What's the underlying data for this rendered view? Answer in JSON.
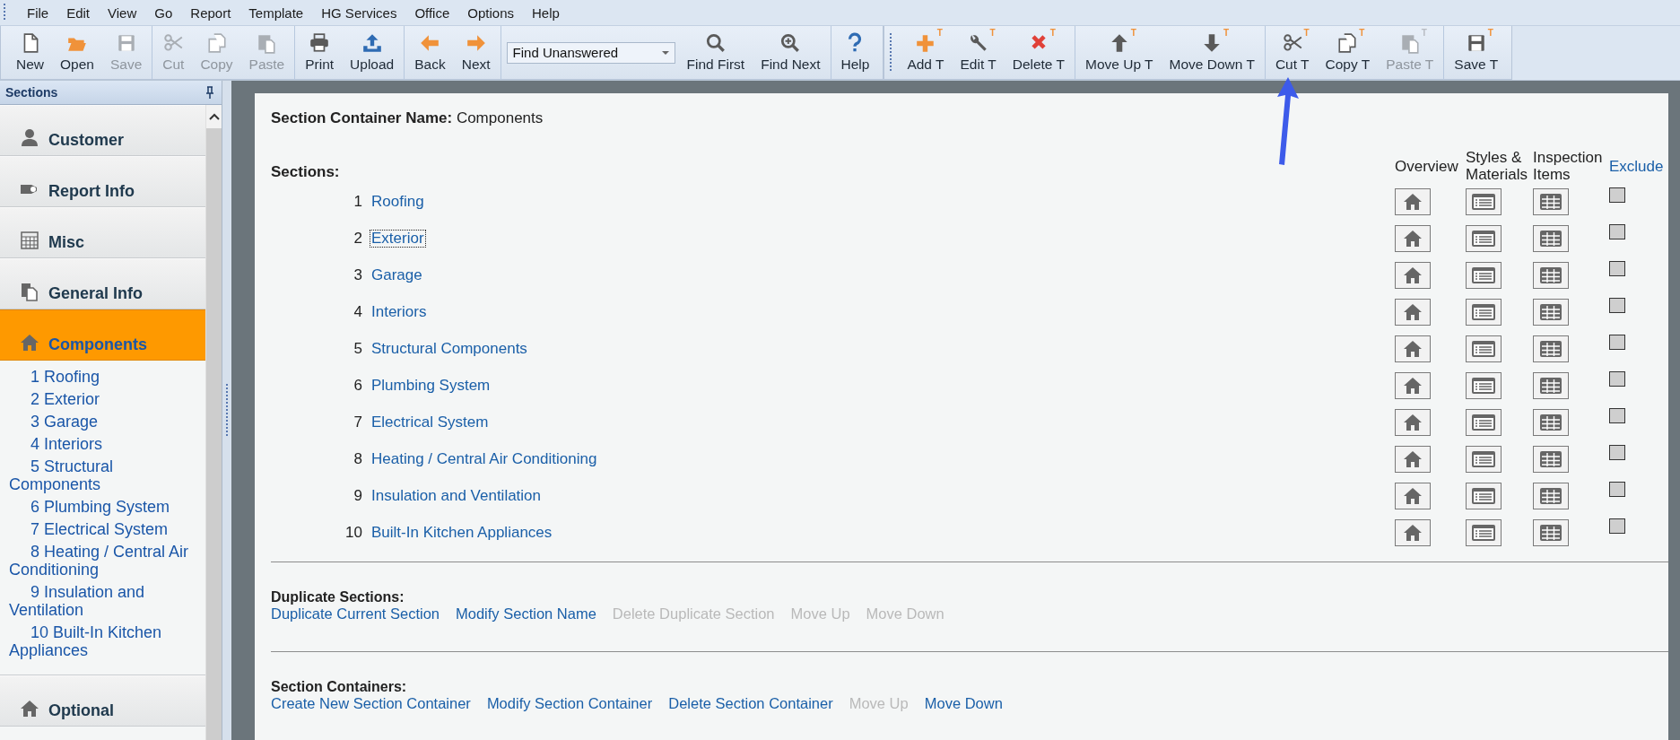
{
  "menu": [
    "File",
    "Edit",
    "View",
    "Go",
    "Report",
    "Template",
    "HG Services",
    "Office",
    "Options",
    "Help"
  ],
  "toolbars": [
    {
      "groups": [
        [
          {
            "kind": "button",
            "label": "New",
            "disabled": false
          },
          {
            "kind": "button",
            "label": "Open",
            "disabled": false
          },
          {
            "kind": "button",
            "label": "Save",
            "disabled": true
          }
        ],
        [
          {
            "kind": "button",
            "label": "Cut",
            "disabled": true
          },
          {
            "kind": "button",
            "label": "Copy",
            "disabled": true
          },
          {
            "kind": "button",
            "label": "Paste",
            "disabled": true
          }
        ],
        [
          {
            "kind": "button",
            "label": "Print",
            "disabled": false
          },
          {
            "kind": "button",
            "label": "Upload",
            "disabled": false
          }
        ],
        [
          {
            "kind": "button",
            "label": "Back",
            "disabled": false
          },
          {
            "kind": "button",
            "label": "Next",
            "disabled": false
          }
        ],
        [
          {
            "kind": "dropdown",
            "value": "Find Unanswered"
          },
          {
            "kind": "button",
            "label": "Find First",
            "disabled": false
          },
          {
            "kind": "button",
            "label": "Find Next",
            "disabled": false
          }
        ],
        [
          {
            "kind": "button",
            "label": "Help",
            "disabled": false
          }
        ]
      ]
    },
    {
      "groups": [
        [
          {
            "kind": "button",
            "label": "Add T",
            "badge": "T",
            "disabled": false
          },
          {
            "kind": "button",
            "label": "Edit T",
            "badge": "T",
            "disabled": false
          },
          {
            "kind": "button",
            "label": "Delete T",
            "badge": "T",
            "disabled": false
          }
        ],
        [
          {
            "kind": "button",
            "label": "Move Up T",
            "badge": "T",
            "disabled": false
          },
          {
            "kind": "button",
            "label": "Move Down T",
            "badge": "T",
            "disabled": false
          }
        ],
        [
          {
            "kind": "button",
            "label": "Cut T",
            "badge": "T",
            "disabled": false
          },
          {
            "kind": "button",
            "label": "Copy T",
            "badge": "T",
            "disabled": false
          },
          {
            "kind": "button",
            "label": "Paste T",
            "badge": "T",
            "disabled": true
          }
        ],
        [
          {
            "kind": "button",
            "label": "Save T",
            "badge": "T",
            "disabled": false
          }
        ]
      ]
    }
  ],
  "sidebar": {
    "title": "Sections",
    "items": [
      {
        "label": "Customer",
        "selected": false
      },
      {
        "label": "Report Info",
        "selected": false
      },
      {
        "label": "Misc",
        "selected": false
      },
      {
        "label": "General Info",
        "selected": false
      },
      {
        "label": "Components",
        "selected": true,
        "children": [
          "1 Roofing",
          "2 Exterior",
          "3 Garage",
          "4 Interiors",
          "5 Structural Components",
          "6 Plumbing System",
          "7 Electrical System",
          "8 Heating / Central Air Conditioning",
          "9 Insulation and Ventilation",
          "10 Built-In Kitchen Appliances"
        ]
      },
      {
        "label": "Optional",
        "selected": false
      }
    ]
  },
  "main": {
    "container_name": {
      "label": "Section Container Name:",
      "value": "Components"
    },
    "sections_label": "Sections:",
    "columns": [
      {
        "label": "Overview",
        "link": false
      },
      {
        "label": "Styles & Materials",
        "link": false
      },
      {
        "label": "Inspection Items",
        "link": false
      },
      {
        "label": "Exclude",
        "link": true
      }
    ],
    "sections": [
      {
        "number": "1",
        "name": "Roofing",
        "focused": false,
        "exclude": false
      },
      {
        "number": "2",
        "name": "Exterior",
        "focused": true,
        "exclude": false
      },
      {
        "number": "3",
        "name": "Garage",
        "focused": false,
        "exclude": false
      },
      {
        "number": "4",
        "name": "Interiors",
        "focused": false,
        "exclude": false
      },
      {
        "number": "5",
        "name": "Structural Components",
        "focused": false,
        "exclude": false
      },
      {
        "number": "6",
        "name": "Plumbing System",
        "focused": false,
        "exclude": false
      },
      {
        "number": "7",
        "name": "Electrical System",
        "focused": false,
        "exclude": false
      },
      {
        "number": "8",
        "name": "Heating / Central Air Conditioning",
        "focused": false,
        "exclude": false
      },
      {
        "number": "9",
        "name": "Insulation and Ventilation",
        "focused": false,
        "exclude": false
      },
      {
        "number": "10",
        "name": "Built-In Kitchen Appliances",
        "focused": false,
        "exclude": false
      }
    ],
    "action_groups": [
      {
        "title": "Duplicate Sections:",
        "links": [
          {
            "label": "Duplicate Current Section",
            "disabled": false
          },
          {
            "label": "Modify Section Name",
            "disabled": false
          },
          {
            "label": "Delete Duplicate Section",
            "disabled": true
          },
          {
            "label": "Move Up",
            "disabled": true
          },
          {
            "label": "Move Down",
            "disabled": true
          }
        ]
      },
      {
        "title": "Section Containers:",
        "links": [
          {
            "label": "Create New Section Container",
            "disabled": false
          },
          {
            "label": "Modify Section Container",
            "disabled": false
          },
          {
            "label": "Delete Section Container",
            "disabled": false
          },
          {
            "label": "Move Up",
            "disabled": true
          },
          {
            "label": "Move Down",
            "disabled": false
          }
        ]
      }
    ]
  }
}
